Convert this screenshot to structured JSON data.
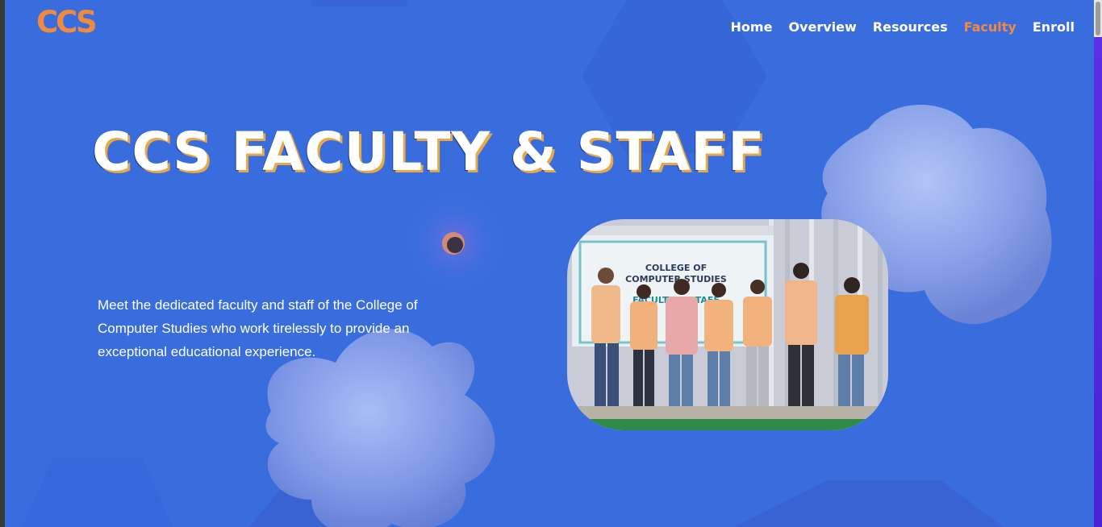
{
  "brand": {
    "logo_text": "CCS",
    "accent_color": "#f08a3e",
    "background_color": "#396dde"
  },
  "nav": {
    "items": [
      {
        "label": "Home",
        "active": false
      },
      {
        "label": "Overview",
        "active": false
      },
      {
        "label": "Resources",
        "active": false
      },
      {
        "label": "Faculty",
        "active": true
      },
      {
        "label": "Enroll",
        "active": false
      }
    ]
  },
  "hero": {
    "title": "CCS FACULTY & STAFF",
    "description": "Meet the dedicated faculty and staff of the College of Computer Studies who work tirelessly to provide an exceptional educational experience."
  },
  "photo": {
    "banner_line1": "COLLEGE OF",
    "banner_line2": "COMPUTER STUDIES",
    "banner_line3": "FACULTY & STAFF"
  }
}
